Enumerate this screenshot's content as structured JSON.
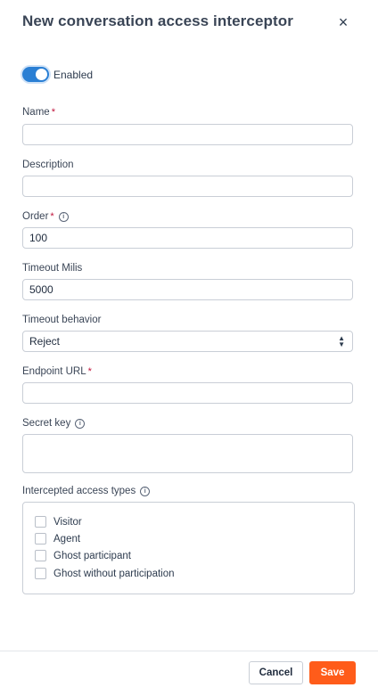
{
  "dialog": {
    "title": "New conversation access interceptor",
    "close_icon": "×"
  },
  "enabled": {
    "label": "Enabled",
    "value": true
  },
  "fields": {
    "name": {
      "label": "Name",
      "required_mark": "*",
      "value": ""
    },
    "description": {
      "label": "Description",
      "value": ""
    },
    "order": {
      "label": "Order",
      "required_mark": "*",
      "info": "i",
      "value": "100"
    },
    "timeout_milis": {
      "label": "Timeout Milis",
      "value": "5000"
    },
    "timeout_behavior": {
      "label": "Timeout behavior",
      "value": "Reject"
    },
    "endpoint_url": {
      "label": "Endpoint URL",
      "required_mark": "*",
      "value": ""
    },
    "secret_key": {
      "label": "Secret key",
      "info": "i",
      "value": ""
    }
  },
  "intercepted_types": {
    "label": "Intercepted access types",
    "info": "i",
    "options": [
      "Visitor",
      "Agent",
      "Ghost participant",
      "Ghost without participation"
    ]
  },
  "footer": {
    "cancel_label": "Cancel",
    "save_label": "Save"
  },
  "colors": {
    "accent": "#2a7fd4",
    "save": "#ff5c1a",
    "required": "#c0143c"
  }
}
